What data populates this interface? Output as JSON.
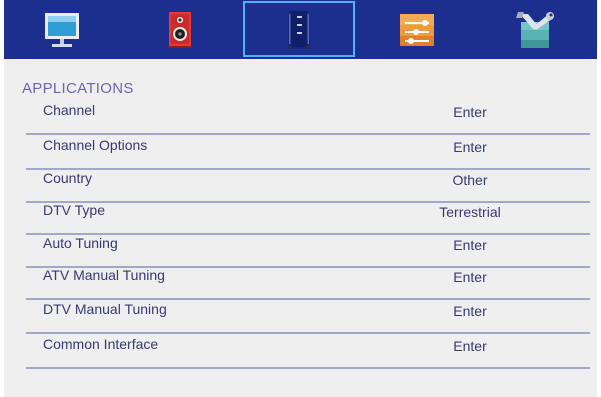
{
  "tabs": [
    {
      "id": "picture",
      "icon": "monitor-icon",
      "selected": false
    },
    {
      "id": "sound",
      "icon": "speaker-icon",
      "selected": false
    },
    {
      "id": "channel",
      "icon": "channel-icon",
      "selected": true
    },
    {
      "id": "function",
      "icon": "sliders-icon",
      "selected": false
    },
    {
      "id": "setup",
      "icon": "tools-icon",
      "selected": false
    }
  ],
  "section_title": "APPLICATIONS",
  "menu": [
    {
      "label": "Channel",
      "value": "Enter"
    },
    {
      "label": "Channel Options",
      "value": "Enter"
    },
    {
      "label": "Country",
      "value": "Other"
    },
    {
      "label": "DTV Type",
      "value": "Terrestrial"
    },
    {
      "label": "Auto Tuning",
      "value": "Enter"
    },
    {
      "label": "ATV Manual Tuning",
      "value": "Enter"
    },
    {
      "label": "DTV Manual Tuning",
      "value": "Enter"
    },
    {
      "label": "Common Interface",
      "value": "Enter"
    }
  ],
  "colors": {
    "top_bar": "#1c2f8f",
    "selected_tab_border": "#4fb3f2",
    "section_title": "#6f61b4",
    "menu_text": "#383874",
    "divider": "#a3a8c8",
    "background": "#efefef"
  }
}
